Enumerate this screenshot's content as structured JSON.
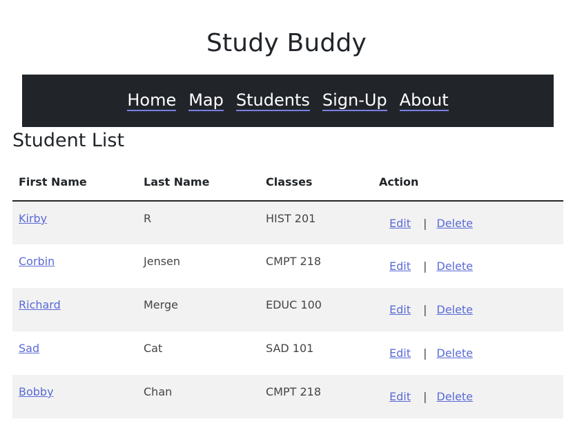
{
  "header": {
    "title": "Study Buddy"
  },
  "nav": {
    "items": [
      {
        "label": "Home"
      },
      {
        "label": "Map"
      },
      {
        "label": "Students"
      },
      {
        "label": "Sign-Up"
      },
      {
        "label": "About"
      }
    ]
  },
  "main": {
    "section_title": "Student List",
    "table": {
      "columns": [
        "First Name",
        "Last Name",
        "Classes",
        "Action"
      ],
      "action_labels": {
        "edit": "Edit",
        "separator": "|",
        "delete": "Delete"
      },
      "rows": [
        {
          "first": "Kirby",
          "last": "R",
          "classes": "HIST 201"
        },
        {
          "first": "Corbin",
          "last": "Jensen",
          "classes": "CMPT 218"
        },
        {
          "first": "Richard",
          "last": "Merge",
          "classes": "EDUC 100"
        },
        {
          "first": "Sad",
          "last": "Cat",
          "classes": "SAD 101"
        },
        {
          "first": "Bobby",
          "last": "Chan",
          "classes": "CMPT 218"
        }
      ]
    }
  }
}
